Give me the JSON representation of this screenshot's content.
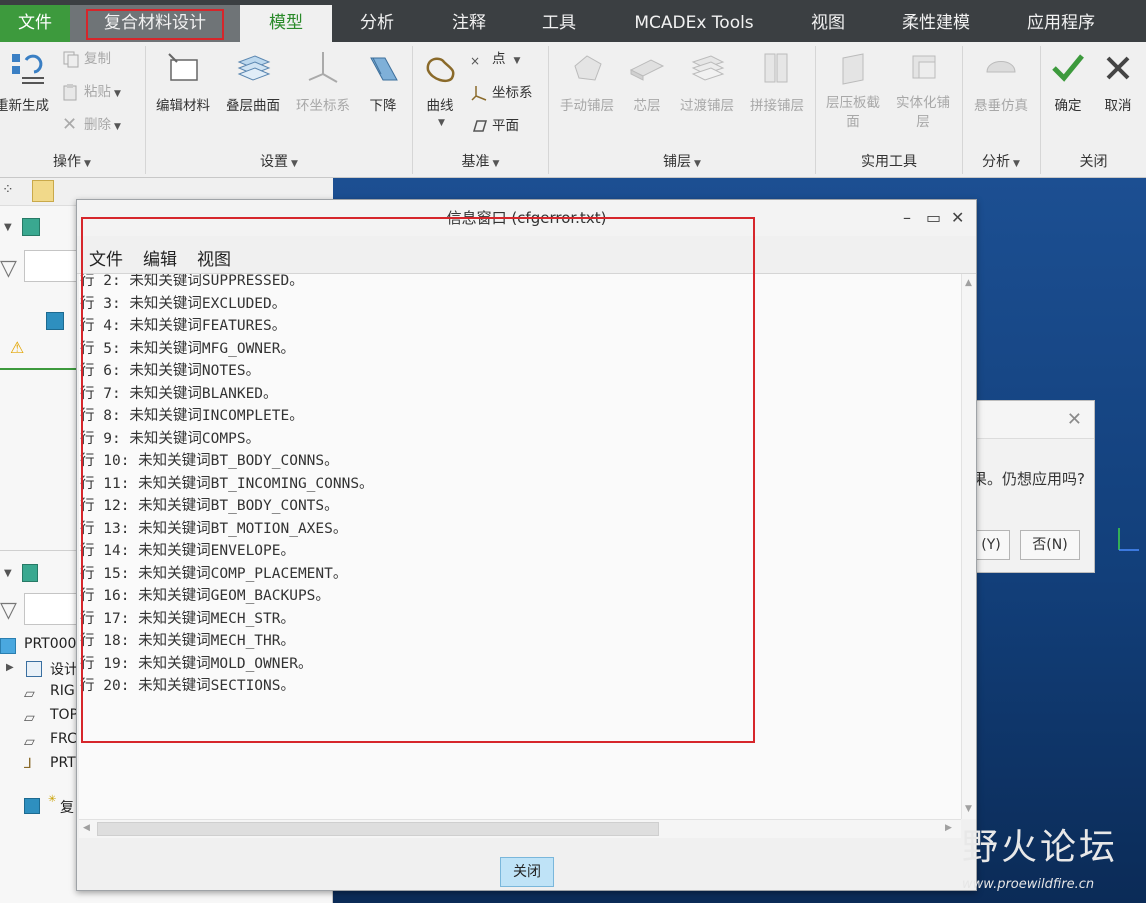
{
  "menubar": {
    "tabs": [
      "文件",
      "复合材料设计",
      "模型",
      "分析",
      "注释",
      "工具",
      "MCADEx Tools",
      "视图",
      "柔性建模",
      "应用程序"
    ]
  },
  "ribbon": {
    "operations": {
      "regenerate": "重新生成",
      "copy": "复制",
      "paste": "粘贴",
      "delete": "删除",
      "group": "操作"
    },
    "settings": {
      "edit_material": "编辑材料",
      "layup_surface": "叠层曲面",
      "ring_csys": "环坐标系",
      "drop": "下降",
      "group": "设置"
    },
    "datum": {
      "curve": "曲线",
      "point": "点",
      "csys": "坐标系",
      "plane": "平面",
      "group": "基准"
    },
    "plies": {
      "manual_ply": "手动铺层",
      "core": "芯层",
      "transition_ply": "过渡铺层",
      "splice_ply": "拼接铺层",
      "group": "铺层"
    },
    "utilities": {
      "laminate_section": "层压板截面",
      "solidify_ply": "实体化铺层",
      "group": "实用工具"
    },
    "analysis": {
      "drape_sim": "悬垂仿真",
      "group": "分析"
    },
    "close": {
      "ok": "确定",
      "cancel": "取消",
      "group": "关闭"
    }
  },
  "left_panel": {
    "tree_items": [
      "PRT000",
      "设计",
      "RIG",
      "TOP",
      "FRC",
      "PRT",
      "复"
    ]
  },
  "back_dialog": {
    "message": "果。仍想应用吗?",
    "yes": "(Y)",
    "no": "否(N)"
  },
  "info_window": {
    "title": "信息窗口 (cfgerror.txt)",
    "menus": [
      "文件",
      "编辑",
      "视图"
    ],
    "lines": [
      "行 2: 未知关键词SUPPRESSED。",
      "行 3: 未知关键词EXCLUDED。",
      "行 4: 未知关键词FEATURES。",
      "行 5: 未知关键词MFG_OWNER。",
      "行 6: 未知关键词NOTES。",
      "行 7: 未知关键词BLANKED。",
      "行 8: 未知关键词INCOMPLETE。",
      "行 9: 未知关键词COMPS。",
      "行 10: 未知关键词BT_BODY_CONNS。",
      "行 11: 未知关键词BT_INCOMING_CONNS。",
      "行 12: 未知关键词BT_BODY_CONTS。",
      "行 13: 未知关键词BT_MOTION_AXES。",
      "行 14: 未知关键词ENVELOPE。",
      "行 15: 未知关键词COMP_PLACEMENT。",
      "行 16: 未知关键词GEOM_BACKUPS。",
      "行 17: 未知关键词MECH_STR。",
      "行 18: 未知关键词MECH_THR。",
      "行 19: 未知关键词MOLD_OWNER。",
      "行 20: 未知关键词SECTIONS。"
    ],
    "close_button": "关闭"
  },
  "watermark": {
    "name": "野火论坛",
    "url": "www.proewildfire.cn"
  },
  "colors": {
    "accent_green": "#3d9a3d",
    "highlight_red": "#d6262b",
    "graphics_blue": "#174a8a"
  }
}
